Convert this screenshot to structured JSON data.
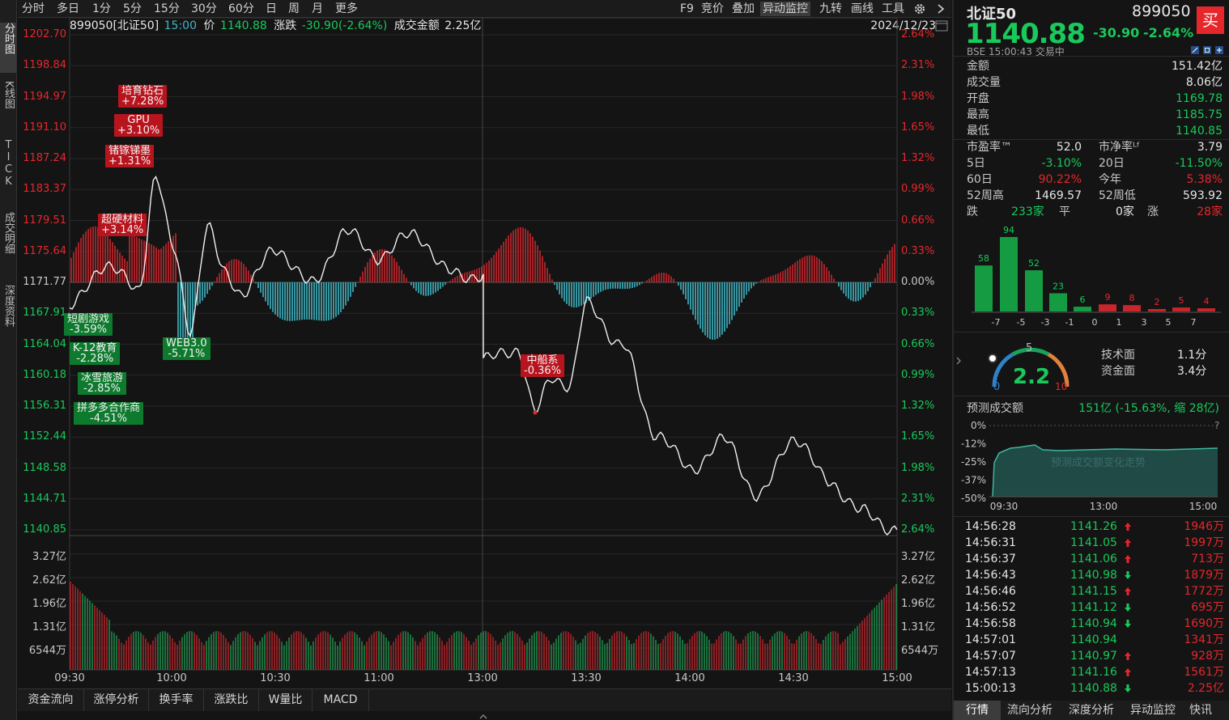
{
  "left_tabs": [
    "分时图",
    "K线图",
    "TICK",
    "成交明细",
    "深度资料"
  ],
  "toolbar": {
    "periods": [
      "分时",
      "多日",
      "1分",
      "5分",
      "15分",
      "30分",
      "60分",
      "日",
      "周",
      "月",
      "更多"
    ],
    "right_items": [
      "F9",
      "竞价",
      "叠加",
      "异动监控",
      "九转",
      "画线",
      "工具"
    ],
    "active": "异动监控"
  },
  "info": {
    "code": "899050[北证50]",
    "time": "15:00",
    "price_label": "价",
    "price": "1140.88",
    "change_label": "涨跌",
    "change": "-30.90(-2.64%)",
    "amount_label": "成交金额",
    "amount": "2.25亿",
    "date": "2024/12/23"
  },
  "price_axis": [
    "1202.70",
    "1198.84",
    "1194.97",
    "1191.10",
    "1187.24",
    "1183.37",
    "1179.51",
    "1175.64",
    "1171.77",
    "1167.91",
    "1164.04",
    "1160.18",
    "1156.31",
    "1152.44",
    "1148.58",
    "1144.71",
    "1140.85"
  ],
  "pct_axis": [
    "2.64%",
    "2.31%",
    "1.98%",
    "1.65%",
    "1.32%",
    "0.99%",
    "0.66%",
    "0.33%",
    "0.00%",
    "0.33%",
    "0.66%",
    "0.99%",
    "1.32%",
    "1.65%",
    "1.98%",
    "2.31%",
    "2.64%"
  ],
  "vol_axis": [
    "3.27亿",
    "2.62亿",
    "1.96亿",
    "1.31亿",
    "6544万"
  ],
  "vol_axis_right": [
    "3.27亿",
    "2.62亿",
    "1.96亿",
    "1.31亿",
    "6544万"
  ],
  "time_axis": [
    "09:30",
    "10:00",
    "10:30",
    "11:00",
    "13:00",
    "13:30",
    "14:00",
    "14:30",
    "15:00"
  ],
  "chart_data": {
    "type": "line",
    "title": "",
    "prev_close": 1171.77,
    "ylim": [
      1140.85,
      1202.7
    ],
    "x": [
      "09:30",
      "09:40",
      "09:50",
      "09:55",
      "10:00",
      "10:05",
      "10:10",
      "10:15",
      "10:20",
      "10:30",
      "10:40",
      "10:50",
      "11:00",
      "11:10",
      "11:20",
      "11:30",
      "13:00",
      "13:10",
      "13:15",
      "13:20",
      "13:25",
      "13:30",
      "13:40",
      "13:50",
      "14:00",
      "14:10",
      "14:20",
      "14:30",
      "14:40",
      "14:50",
      "15:00"
    ],
    "series": [
      {
        "values": [
          1168.5,
          1174.0,
          1171.0,
          1185.0,
          1176.0,
          1166.0,
          1178.5,
          1173.0,
          1170.5,
          1176.0,
          1171.5,
          1178.0,
          1175.0,
          1178.0,
          1173.0,
          1172.5,
          1162.0,
          1163.5,
          1155.5,
          1160.0,
          1159.0,
          1169.0,
          1164.0,
          1153.0,
          1148.5,
          1152.0,
          1145.0,
          1152.5,
          1147.0,
          1143.0,
          1140.88
        ]
      }
    ]
  },
  "annotations": [
    {
      "name": "培育钻石",
      "pct": "+7.28%",
      "dir": "up"
    },
    {
      "name": "GPU",
      "pct": "+3.10%",
      "dir": "up"
    },
    {
      "name": "锗镓锑墨",
      "pct": "+1.31%",
      "dir": "up"
    },
    {
      "name": "超硬材料",
      "pct": "+3.14%",
      "dir": "up"
    },
    {
      "name": "短剧游戏",
      "pct": "-3.59%",
      "dir": "dn"
    },
    {
      "name": "K-12教育",
      "pct": "-2.28%",
      "dir": "dn"
    },
    {
      "name": "冰雪旅游",
      "pct": "-2.85%",
      "dir": "dn"
    },
    {
      "name": "拼多多合作商",
      "pct": "-4.51%",
      "dir": "dn"
    },
    {
      "name": "WEB3.0",
      "pct": "-5.71%",
      "dir": "dn"
    },
    {
      "name": "中船系",
      "pct": "-0.36%",
      "dir": "up"
    }
  ],
  "bottom_tabs": [
    "资金流向",
    "涨停分析",
    "换手率",
    "涨跌比",
    "W量比",
    "MACD"
  ],
  "quote": {
    "name": "北证50",
    "code": "899050",
    "buy_label": "买",
    "price": "1140.88",
    "change": "-30.90",
    "change_pct": "-2.64%",
    "exchange_line": "BSE  15:00:43  交易中",
    "rows": [
      {
        "label": "金额",
        "value": "151.42亿"
      },
      {
        "label": "成交量",
        "value": "8.06亿"
      },
      {
        "label": "开盘",
        "value": "1169.78"
      },
      {
        "label": "最高",
        "value": "1185.75"
      },
      {
        "label": "最低",
        "value": "1140.85"
      }
    ],
    "pairs": [
      {
        "l1": "市盈率™",
        "v1": "52.0",
        "l2": "市净率ᴸᶠ",
        "v2": "3.79"
      },
      {
        "l1": "5日",
        "v1": "-3.10%",
        "l2": "20日",
        "v2": "-11.50%"
      },
      {
        "l1": "60日",
        "v1": "90.22%",
        "l2": "今年",
        "v2": "5.38%"
      },
      {
        "l1": "52周高",
        "v1": "1469.57",
        "l2": "52周低",
        "v2": "593.92"
      }
    ],
    "breadth": {
      "fall_label": "跌",
      "fall": "233家",
      "flat_label": "平",
      "flat": "0家",
      "rise_label": "涨",
      "rise": "28家"
    }
  },
  "dist_chart": {
    "type": "bar",
    "categories": [
      "-7",
      "-6",
      "-5",
      "-4",
      "-3",
      "-2",
      "-1",
      "0",
      "1",
      "2",
      "3",
      "4",
      "5",
      "6",
      "7"
    ],
    "values": [
      58,
      94,
      52,
      23,
      6,
      9,
      8,
      2,
      5,
      4
    ],
    "axis_labels": [
      "-7",
      "-5",
      "-3",
      "-1",
      "0",
      "1",
      "3",
      "5",
      "7"
    ]
  },
  "gauge": {
    "value": "2.2",
    "min_label": "0",
    "mid_label": "5",
    "max_label": "10",
    "tech_label": "技术面",
    "tech_value": "1.1分",
    "fund_label": "资金面",
    "fund_value": "3.4分"
  },
  "forecast": {
    "label": "预测成交额",
    "value": "151亿 (-15.63%, 缩 28亿)",
    "y_labels": [
      "0%",
      "-12%",
      "-25%",
      "-37%",
      "-50%"
    ],
    "x_labels": [
      "09:30",
      "13:00",
      "15:00"
    ],
    "watermark": "预测成交额变化走势",
    "help": "?"
  },
  "ticks": [
    {
      "time": "14:56:28",
      "price": "1141.26",
      "dir": "up",
      "vol": "1946万"
    },
    {
      "time": "14:56:31",
      "price": "1141.05",
      "dir": "up",
      "vol": "1997万"
    },
    {
      "time": "14:56:37",
      "price": "1141.06",
      "dir": "up",
      "vol": "713万"
    },
    {
      "time": "14:56:43",
      "price": "1140.98",
      "dir": "dn",
      "vol": "1879万"
    },
    {
      "time": "14:56:46",
      "price": "1141.15",
      "dir": "up",
      "vol": "1772万"
    },
    {
      "time": "14:56:52",
      "price": "1141.12",
      "dir": "dn",
      "vol": "695万"
    },
    {
      "time": "14:56:58",
      "price": "1140.94",
      "dir": "dn",
      "vol": "1690万"
    },
    {
      "time": "14:57:01",
      "price": "1140.94",
      "dir": "",
      "vol": "1341万"
    },
    {
      "time": "14:57:07",
      "price": "1140.97",
      "dir": "up",
      "vol": "928万"
    },
    {
      "time": "14:57:13",
      "price": "1141.16",
      "dir": "up",
      "vol": "1561万"
    },
    {
      "time": "15:00:13",
      "price": "1140.88",
      "dir": "dn",
      "vol": "2.25亿"
    }
  ],
  "right_tabs": [
    "行情",
    "流向分析",
    "深度分析",
    "异动监控",
    "快讯"
  ],
  "colors": {
    "up": "#e5272c",
    "down": "#19c95b",
    "cyan": "#3fb6c4",
    "bg": "#141414"
  }
}
